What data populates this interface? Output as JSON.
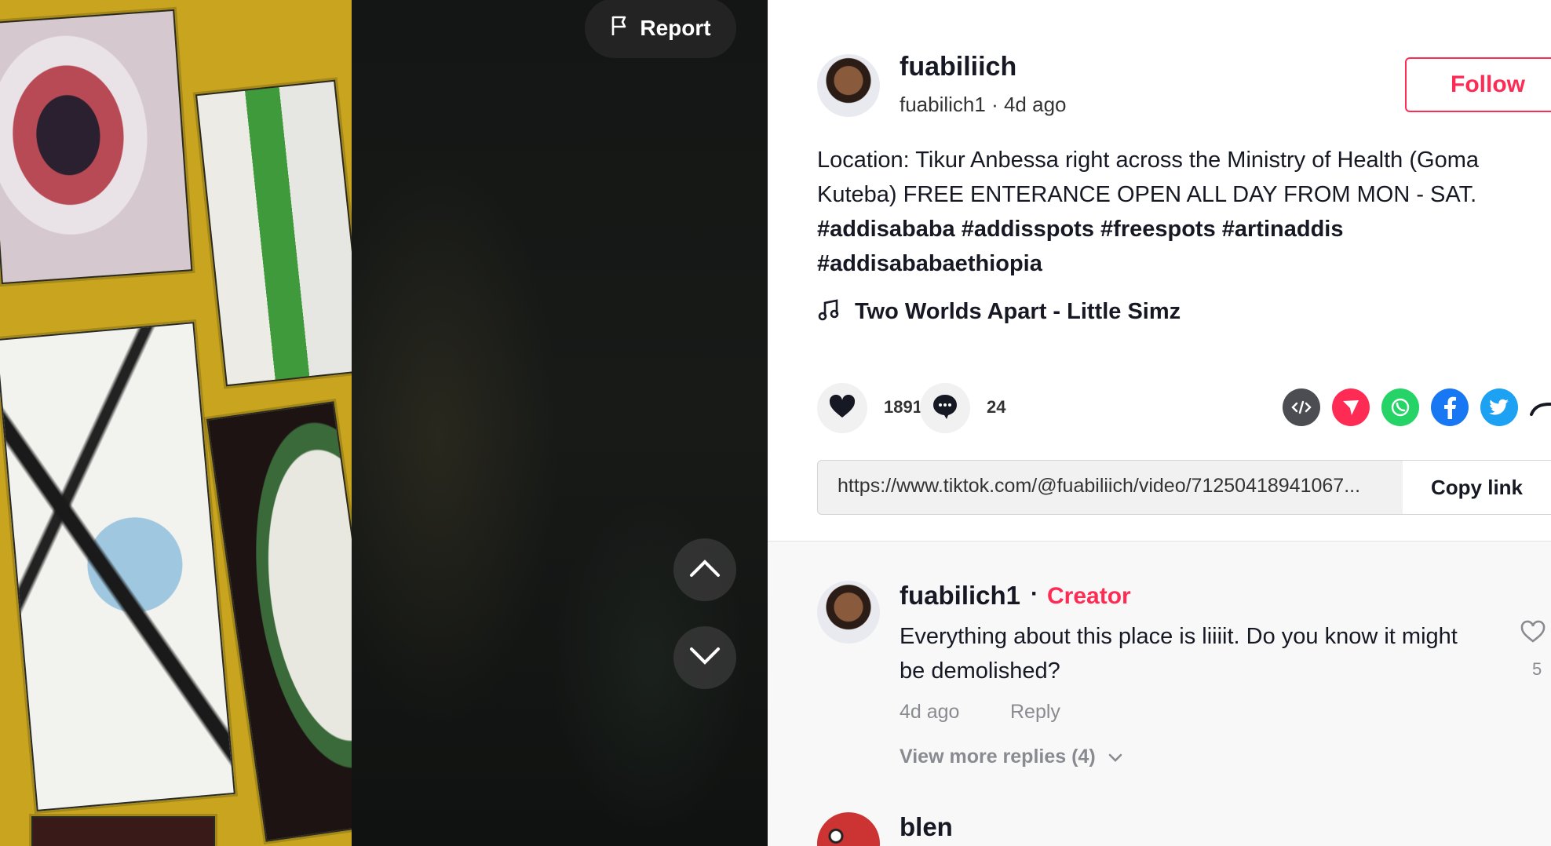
{
  "video": {
    "report_label": "Report"
  },
  "author": {
    "display_name": "fuabiliich",
    "handle": "fuabilich1",
    "separator": " · ",
    "posted_ago": "4d ago",
    "follow_label": "Follow"
  },
  "description": {
    "text": "Location: Tikur Anbessa right across the Ministry of Health (Goma Kuteba) FREE ENTERANCE OPEN ALL DAY FROM MON - SAT.",
    "hashtags": [
      "#addisababa",
      "#addisspots",
      "#freespots",
      "#artinaddis",
      "#addisababaethiopia"
    ]
  },
  "music": {
    "title": "Two Worlds Apart - Little Simz"
  },
  "stats": {
    "likes": "1891",
    "comments": "24"
  },
  "share": {
    "icons": [
      "embed-icon",
      "send-to-friends-icon",
      "whatsapp-icon",
      "facebook-icon",
      "twitter-icon",
      "more-share-icon"
    ],
    "colors": {
      "embed": "#4c4d52",
      "send": "#fe2c55",
      "whatsapp": "#25d366",
      "facebook": "#1877f2",
      "twitter": "#1da1f2"
    }
  },
  "link": {
    "url": "https://www.tiktok.com/@fuabiliich/video/71250418941067...",
    "copy_label": "Copy link"
  },
  "comments": [
    {
      "username": "fuabilich1",
      "dot": "·",
      "badge": "Creator",
      "text": "Everything about this place is liiiit. Do you know it might be demolished?",
      "time": "4d ago",
      "reply_label": "Reply",
      "likes": "5",
      "more_replies": "View more replies (4)"
    },
    {
      "username": "blen"
    }
  ],
  "colors": {
    "accent": "#fe2c55",
    "text_primary": "#161823",
    "text_secondary": "#8a8b91"
  }
}
